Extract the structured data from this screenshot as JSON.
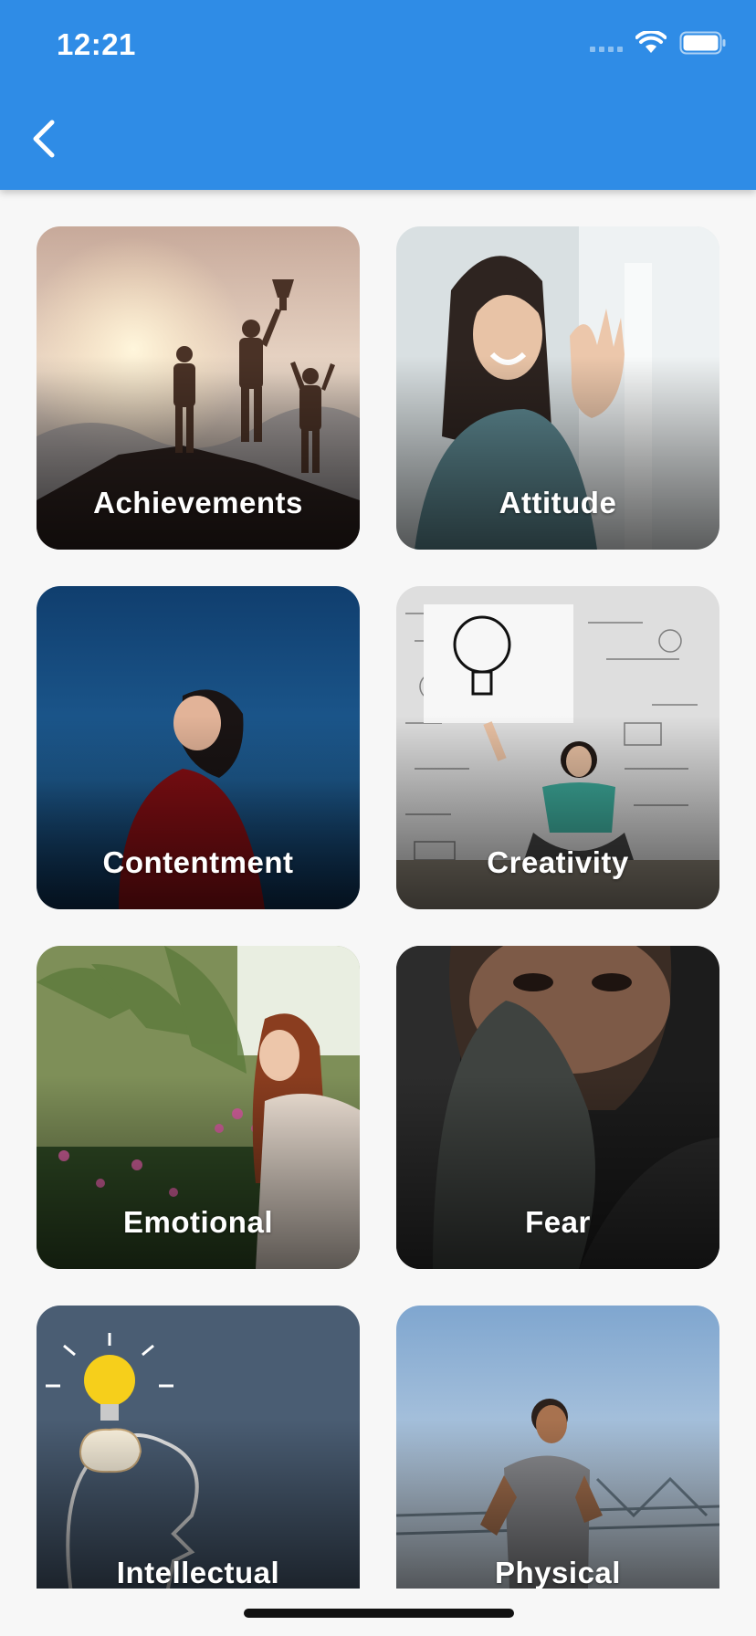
{
  "status_bar": {
    "time": "12:21",
    "icons": [
      "signal-icon",
      "wifi-icon",
      "battery-icon"
    ]
  },
  "app_bar": {
    "color": "#2f8ce6",
    "back_icon": "chevron-left-icon"
  },
  "categories": [
    {
      "label": "Achievements",
      "image": "silhouettes-on-mountain-with-trophy"
    },
    {
      "label": "Attitude",
      "image": "smiling-woman-waving"
    },
    {
      "label": "Contentment",
      "image": "woman-in-red-looking-up-at-blue-sky"
    },
    {
      "label": "Creativity",
      "image": "woman-holding-lightbulb-sketch-sign"
    },
    {
      "label": "Emotional",
      "image": "woman-with-pink-flowers-in-garden"
    },
    {
      "label": "Fear",
      "image": "woman-covering-face-with-sleeve"
    },
    {
      "label": "Intellectual",
      "image": "chalk-head-with-lightbulb-and-brain"
    },
    {
      "label": "Physical",
      "image": "man-jogging-outdoors"
    }
  ]
}
